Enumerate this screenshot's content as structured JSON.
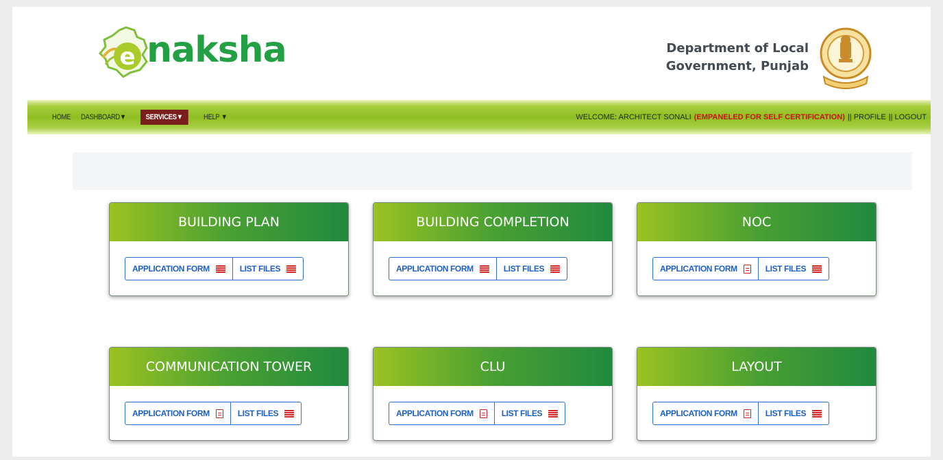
{
  "brand": {
    "logo_text": "naksha"
  },
  "department": {
    "line1": "Department of Local",
    "line2": "Government, Punjab"
  },
  "nav": {
    "items": [
      "HOME",
      "DASHBOARD▼",
      "SERVICES▼",
      "HELP ▼"
    ],
    "welcome": "WELCOME: ARCHITECT SONALI",
    "empaneled": "(EMPANELED FOR SELF CERTIFICATION)",
    "profile": "|| PROFILE",
    "logout": "|| LOGOUT"
  },
  "cards": [
    {
      "title": "BUILDING PLAN",
      "application_label": "APPLICATION FORM",
      "list_label": "LIST FILES",
      "application_icon": "list-icon"
    },
    {
      "title": "BUILDING COMPLETION",
      "application_label": "APPLICATION FORM",
      "list_label": "LIST FILES",
      "application_icon": "list-icon"
    },
    {
      "title": "NOC",
      "application_label": "APPLICATION FORM",
      "list_label": "LIST FILES",
      "application_icon": "document-icon"
    },
    {
      "title": "COMMUNICATION TOWER",
      "application_label": "APPLICATION FORM",
      "list_label": "LIST FILES",
      "application_icon": "document-icon"
    },
    {
      "title": "CLU",
      "application_label": "APPLICATION FORM",
      "list_label": "LIST FILES",
      "application_icon": "document-icon"
    },
    {
      "title": "LAYOUT",
      "application_label": "APPLICATION FORM",
      "list_label": "LIST FILES",
      "application_icon": "document-icon"
    }
  ],
  "colors": {
    "brand_green": "#23a043",
    "active_nav": "#7a1d1d",
    "link_blue": "#1d5fc4",
    "icon_red": "#d42323"
  }
}
